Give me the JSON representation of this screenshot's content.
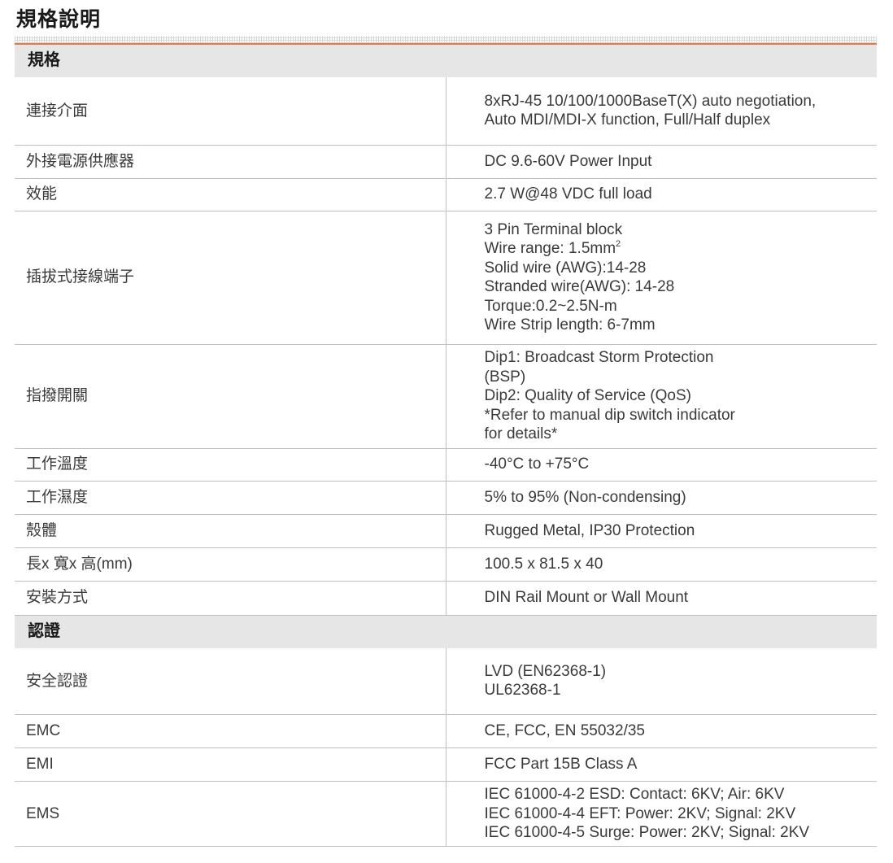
{
  "page_title": "規格說明",
  "sections": [
    {
      "title": "規格",
      "rows": [
        {
          "label": "連接介面",
          "lines": [
            "8xRJ-45 10/100/1000BaseT(X) auto negotiation,",
            "Auto MDI/MDI-X function, Full/Half duplex"
          ]
        },
        {
          "label": "外接電源供應器",
          "lines": [
            "DC 9.6-60V Power Input"
          ]
        },
        {
          "label": "效能",
          "lines": [
            "2.7 W@48 VDC full load"
          ]
        },
        {
          "label": "插拔式接線端子",
          "lines": [
            "3 Pin Terminal block",
            "Wire range: 1.5mm",
            "Solid wire (AWG):14-28",
            "Stranded wire(AWG): 14-28",
            "Torque:0.2~2.5N-m",
            "Wire Strip length: 6-7mm"
          ],
          "superscript": "2"
        },
        {
          "label": "指撥開關",
          "lines": [
            "Dip1: Broadcast Storm Protection",
            "(BSP)",
            "Dip2: Quality of Service (QoS)",
            "*Refer to manual dip switch indicator",
            "for details*"
          ]
        },
        {
          "label": "工作溫度",
          "lines": [
            "-40°C to +75°C"
          ]
        },
        {
          "label": "工作濕度",
          "lines": [
            "5% to 95% (Non-condensing)"
          ]
        },
        {
          "label": "殼體",
          "lines": [
            "Rugged Metal, IP30 Protection"
          ]
        },
        {
          "label": "長x 寬x 高(mm)",
          "lines": [
            "100.5 x 81.5 x 40"
          ]
        },
        {
          "label": "安裝方式",
          "lines": [
            "DIN Rail Mount or Wall Mount"
          ]
        }
      ]
    },
    {
      "title": "認證",
      "rows": [
        {
          "label": "安全認證",
          "lines": [
            "LVD (EN62368-1)",
            "UL62368-1"
          ]
        },
        {
          "label": "EMC",
          "lines": [
            "CE, FCC, EN 55032/35"
          ]
        },
        {
          "label": "EMI",
          "lines": [
            "FCC Part 15B Class A"
          ]
        },
        {
          "label": "EMS",
          "lines": [
            "IEC 61000-4-2 ESD: Contact: 6KV; Air: 6KV",
            "IEC 61000-4-4 EFT: Power: 2KV; Signal: 2KV",
            "IEC 61000-4-5 Surge: Power: 2KV; Signal: 2KV"
          ]
        }
      ]
    }
  ]
}
